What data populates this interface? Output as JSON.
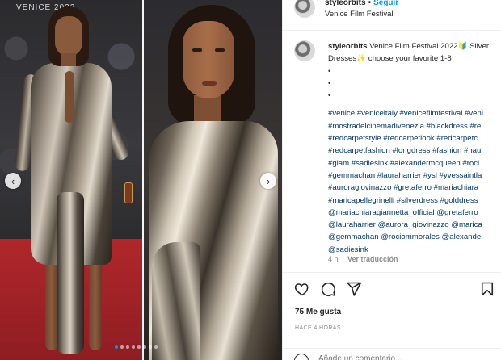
{
  "media": {
    "banner_text": "VENICE 2022",
    "prev_arrow": "‹",
    "next_arrow": "›",
    "slide_count": 8,
    "active_slide": 1
  },
  "header": {
    "username": "styleorbits",
    "separator": "•",
    "follow_label": "Seguir",
    "location": "Venice Film Festival"
  },
  "caption": {
    "username": "styleorbits",
    "text_line1": "Venice Film Festival 2022🔰 Silver",
    "text_line2": "Dresses✨ choose your favorite 1-8",
    "bullets": [
      "•",
      "•",
      "•"
    ],
    "hashtag_lines": [
      "#venice #veniceitaly #venicefilmfestival #veni",
      "#mostradelcinemadivenezia #blackdress #re",
      "#redcarpetstyle #redcarpetlook #redcarpetc",
      "#redcarpetfashion #longdress #fashion #hau",
      "#glam #sadiesink #alexandermcqueen #roci",
      "#gemmachan #lauraharrier #ysl #yvessaintla",
      "#auroragiovinazzo #gretaferro #mariachiara",
      "#maricapellegrinelli #silverdress #golddress",
      "@mariachiaragiannetta_official @gretaferro",
      "@lauraharrier @aurora_giovinazzo @marica",
      "@gemmachan @rociommorales @alexande",
      "@sadiesink_"
    ]
  },
  "meta": {
    "age": "4 h",
    "translate_label": "Ver traducción"
  },
  "actions": {
    "heart_icon": "heart-icon",
    "comment_icon": "comment-icon",
    "share_icon": "share-icon",
    "save_icon": "bookmark-icon",
    "likes": "75 Me gusta",
    "timestamp": "HACE 4 HORAS"
  },
  "comment": {
    "placeholder": "Añade un comentario..."
  }
}
